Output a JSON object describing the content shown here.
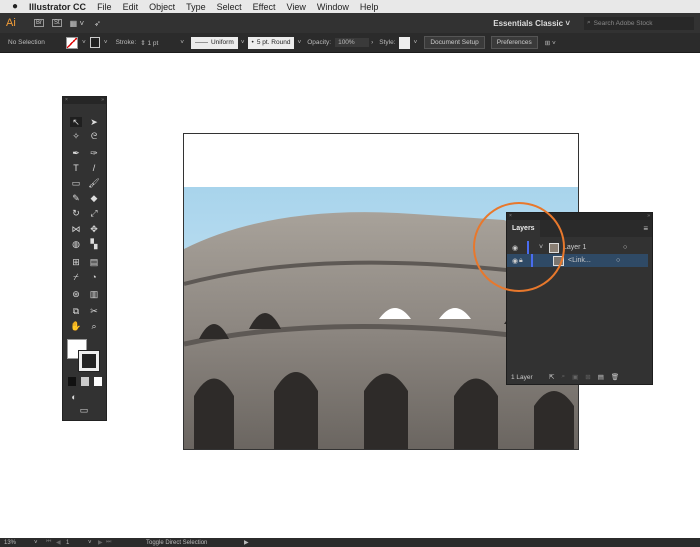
{
  "menubar": {
    "apple": "",
    "app": "Illustrator CC",
    "items": [
      "File",
      "Edit",
      "Object",
      "Type",
      "Select",
      "Effect",
      "View",
      "Window",
      "Help"
    ]
  },
  "appbar": {
    "logo": "Ai",
    "br": "Br",
    "st": "St",
    "workspace": "Essentials Classic",
    "search_placeholder": "Search Adobe Stock"
  },
  "control": {
    "selection": "No Selection",
    "stroke_label": "Stroke:",
    "stroke_value": "1 pt",
    "profile": "Uniform",
    "brush": "5 pt. Round",
    "opacity_label": "Opacity:",
    "opacity_value": "100%",
    "style_label": "Style:",
    "doc_setup": "Document Setup",
    "preferences": "Preferences"
  },
  "layers": {
    "tab": "Layers",
    "rows": [
      {
        "name": "Layer 1",
        "selected": false
      },
      {
        "name": "<Link...",
        "selected": true
      }
    ],
    "footer": "1 Layer",
    "accent": "#4a6cf0"
  },
  "status": {
    "zoom": "13%",
    "page": "1",
    "tool": "Toggle Direct Selection"
  },
  "colors": {
    "highlight_circle": "#e8782c"
  }
}
